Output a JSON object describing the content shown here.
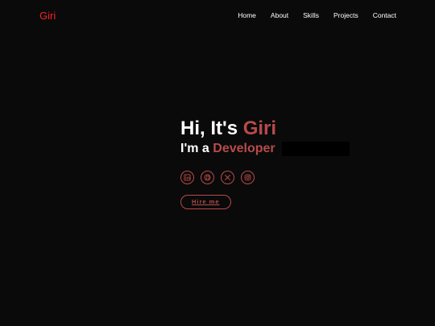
{
  "brand": {
    "logo": "Giri"
  },
  "nav": {
    "items": [
      {
        "label": "Home"
      },
      {
        "label": "About"
      },
      {
        "label": "Skills"
      },
      {
        "label": "Projects"
      },
      {
        "label": "Contact"
      }
    ]
  },
  "hero": {
    "greeting": "Hi, It's ",
    "name": "Giri",
    "role_prefix": "I'm a ",
    "role": "Developer",
    "hire_label": "Hire me"
  },
  "socials": [
    {
      "icon": "linkedin-icon"
    },
    {
      "icon": "github-icon"
    },
    {
      "icon": "x-icon"
    },
    {
      "icon": "instagram-icon"
    }
  ],
  "colors": {
    "background": "#0a0a0a",
    "logo": "#ff1f1f",
    "accent": "#b94a4a",
    "text": "#ffffff"
  }
}
